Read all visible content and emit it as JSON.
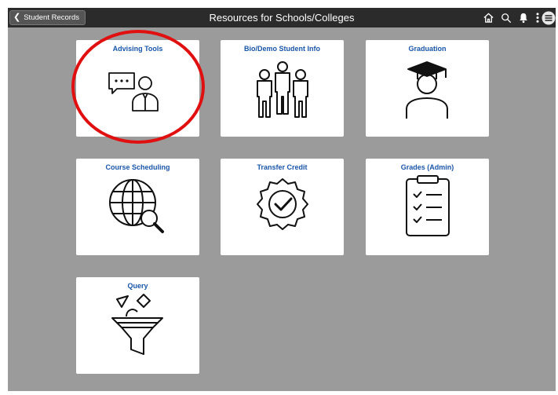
{
  "header": {
    "back_label": "Student Records",
    "title": "Resources for Schools/Colleges"
  },
  "icons": {
    "home": "home-icon",
    "search": "search-icon",
    "notifications": "bell-icon",
    "actions": "more-vertical-icon",
    "nav": "nav-bar-icon"
  },
  "tiles": [
    {
      "label": "Advising Tools",
      "icon": "advising-chat-person-icon"
    },
    {
      "label": "Bio/Demo Student Info",
      "icon": "people-group-icon"
    },
    {
      "label": "Graduation",
      "icon": "graduate-cap-person-icon"
    },
    {
      "label": "Course Scheduling",
      "icon": "globe-search-icon"
    },
    {
      "label": "Transfer Credit",
      "icon": "badge-check-icon"
    },
    {
      "label": "Grades (Admin)",
      "icon": "clipboard-checklist-icon"
    },
    {
      "label": "Query",
      "icon": "filter-funnel-icon"
    }
  ],
  "colors": {
    "topbar": "#2b2b2b",
    "background": "#9b9b9b",
    "tile_label": "#1a55a8",
    "annotation": "#e01010"
  }
}
